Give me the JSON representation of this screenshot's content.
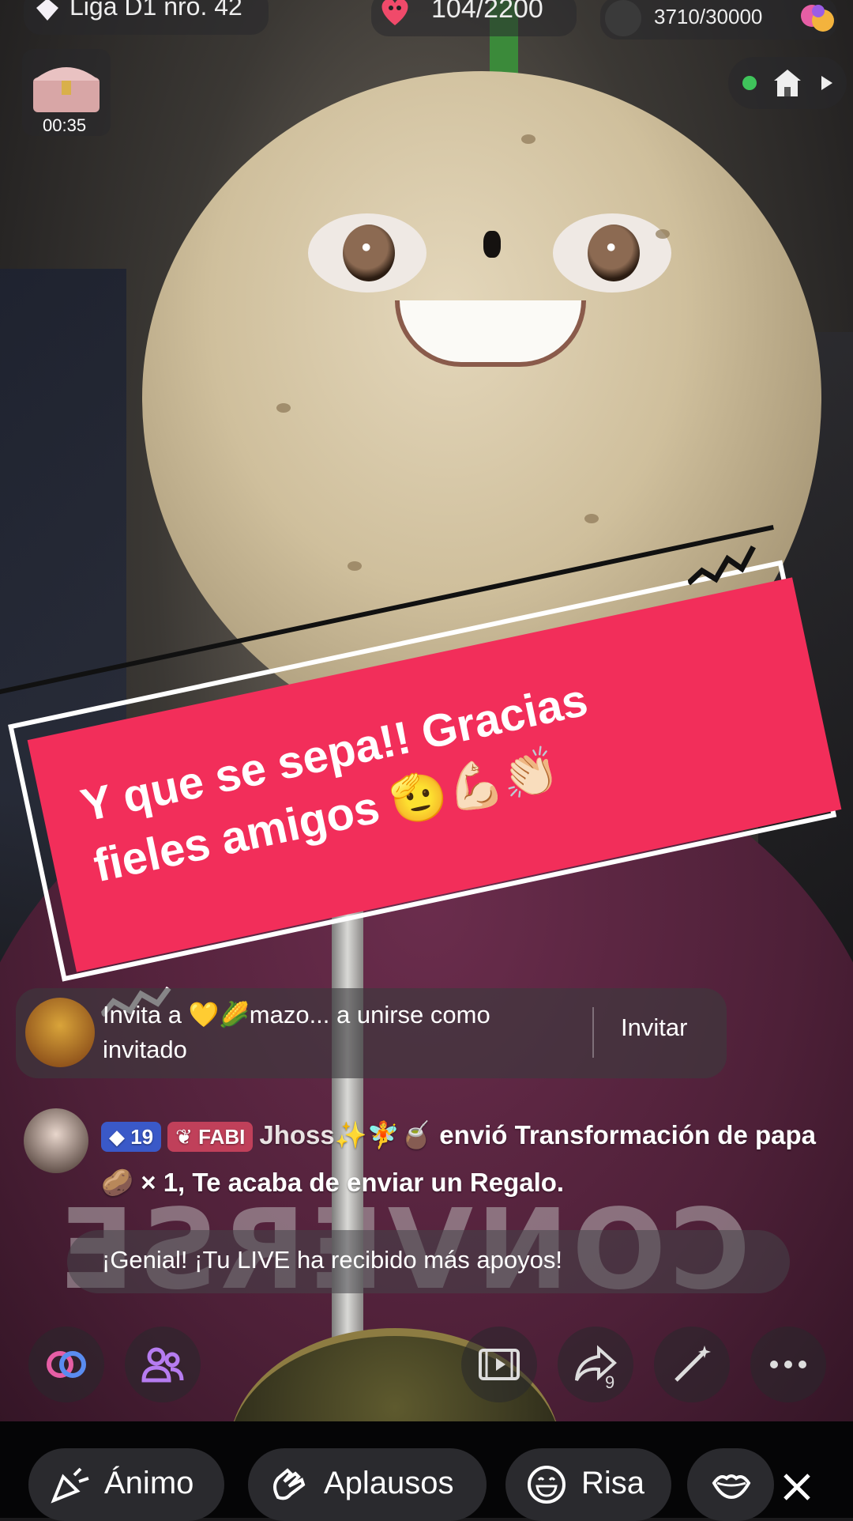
{
  "top_bar": {
    "league_label": "Liga D1 nro. 42",
    "goal_progress": "104/2200",
    "points_progress": "3710/30000"
  },
  "treasure": {
    "timer": "00:35"
  },
  "live_controls": {
    "status_dot_color": "#3fc45b"
  },
  "banner": {
    "text": "Y que se sepa!! Gracias\nfieles amigos 🫡💪🏻👏🏻",
    "background_color": "#f22e5a"
  },
  "invite_card": {
    "message": "Invita a 💛🌽mazo... a unirse como\ninvitado",
    "button_label": "Invitar"
  },
  "gift_message": {
    "level_badge": "19",
    "fan_badge": "FABI",
    "username": "Jhoss✨🧚🧉",
    "action_text": " envió Transformación de papa🥔 × 1, Te acaba de enviar un Regalo."
  },
  "toast": {
    "text": "¡Genial! ¡Tu LIVE ha recibido más apoyos!"
  },
  "share": {
    "count": "9"
  },
  "quick_reactions": [
    {
      "label": "Ánimo",
      "icon": "cheer-icon"
    },
    {
      "label": "Aplausos",
      "icon": "clap-icon"
    },
    {
      "label": "Risa",
      "icon": "laugh-icon"
    }
  ]
}
